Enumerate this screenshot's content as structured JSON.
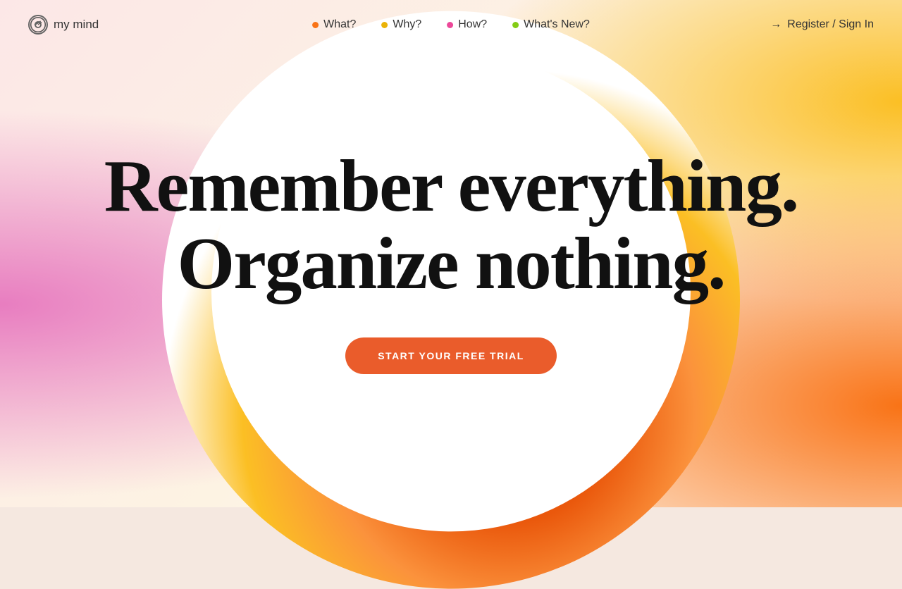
{
  "logo": {
    "name": "my mind",
    "icon_label": "mind-icon"
  },
  "nav": {
    "links": [
      {
        "label": "What?",
        "dot_color": "dot-red",
        "dot_name": "what-dot"
      },
      {
        "label": "Why?",
        "dot_color": "dot-yellow",
        "dot_name": "why-dot"
      },
      {
        "label": "How?",
        "dot_color": "dot-pink",
        "dot_name": "how-dot"
      },
      {
        "label": "What's New?",
        "dot_color": "dot-green",
        "dot_name": "whats-new-dot"
      }
    ],
    "register_label": "Register / Sign In",
    "register_arrow": "→"
  },
  "hero": {
    "line1": "Remember everything.",
    "line2": "Organize nothing.",
    "cta": "START YOUR FREE TRIAL"
  }
}
